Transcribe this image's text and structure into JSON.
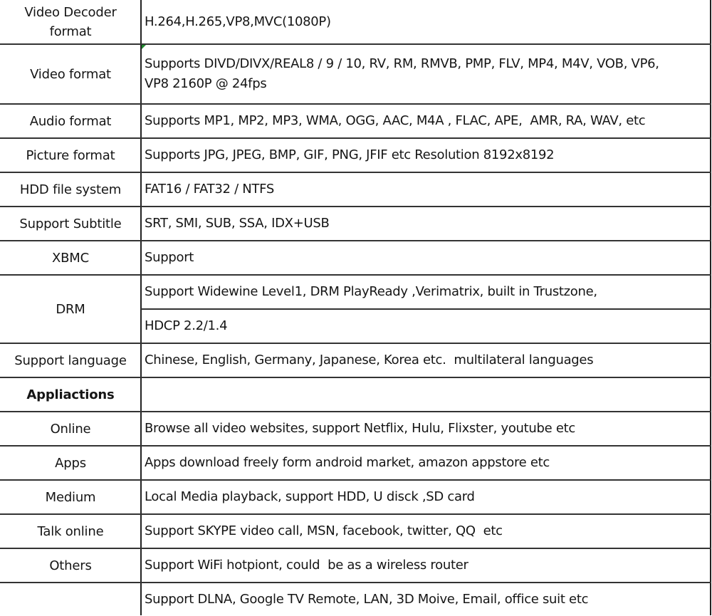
{
  "table": {
    "rows": [
      {
        "label": "Video Decoder\nformat",
        "value": "H.264,H.265,VP8,MVC(1080P)"
      },
      {
        "label": "Video format",
        "value": "Supports DIVD/DIVX/REAL8 / 9 / 10, RV, RM, RMVB, PMP, FLV, MP4, M4V, VOB, VP6,\nVP8 2160P @ 24fps"
      },
      {
        "label": "Audio format",
        "value": "Supports MP1, MP2, MP3, WMA, OGG, AAC, M4A , FLAC, APE,  AMR, RA, WAV, etc"
      },
      {
        "label": "Picture format",
        "value": "Supports JPG, JPEG, BMP, GIF, PNG, JFIF etc Resolution 8192x8192"
      },
      {
        "label": "HDD file system",
        "value": "FAT16 / FAT32 / NTFS"
      },
      {
        "label": "Support Subtitle",
        "value": "SRT, SMI, SUB, SSA, IDX+USB"
      },
      {
        "label": "XBMC",
        "value": "Support"
      },
      {
        "label": "DRM",
        "values": [
          "Support Widewine Level1, DRM PlayReady ,Verimatrix, built in Trustzone,",
          "HDCP 2.2/1.4"
        ]
      },
      {
        "label": "Support language",
        "value": "Chinese, English, Germany, Japanese, Korea etc.  multilateral languages"
      },
      {
        "label": "Appliactions",
        "value": ""
      },
      {
        "label": "Online",
        "value": "Browse all video websites, support Netflix, Hulu, Flixster, youtube etc"
      },
      {
        "label": "Apps",
        "value": "Apps download freely form android market, amazon appstore etc"
      },
      {
        "label": "Medium",
        "value": "Local Media playback, support HDD, U disck ,SD card"
      },
      {
        "label": "Talk online",
        "value": "Support SKYPE video call, MSN, facebook, twitter, QQ  etc"
      },
      {
        "label": "Others",
        "value": "Support WiFi hotpiont, could  be as a wireless router"
      },
      {
        "label": "",
        "value": "Support DLNA, Google TV Remote, LAN, 3D Moive, Email, office suit etc"
      }
    ]
  },
  "colors": {
    "grid_line": "#333333",
    "text": "#151515",
    "background": "#ffffff",
    "comment_marker": "#1f8a2e"
  }
}
